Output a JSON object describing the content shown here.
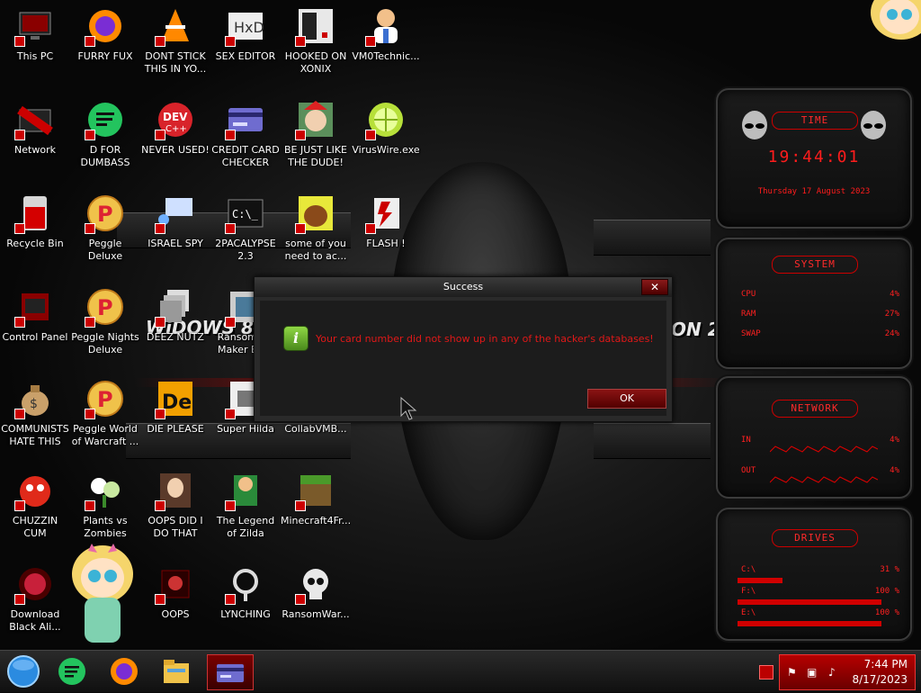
{
  "desktop_icons": [
    {
      "label": "This PC",
      "icon": "monitor-icon",
      "col": 0,
      "row": 0
    },
    {
      "label": "FURRY FUX",
      "icon": "firefox-icon",
      "col": 1,
      "row": 0
    },
    {
      "label": "DONT STICK THIS IN YO...",
      "icon": "vlc-cone-icon",
      "col": 2,
      "row": 0
    },
    {
      "label": "SEX EDITOR",
      "icon": "hxd-editor-icon",
      "col": 3,
      "row": 0
    },
    {
      "label": "HOOKED ON XONIX",
      "icon": "xonix-game-icon",
      "col": 4,
      "row": 0
    },
    {
      "label": "VM0Technic...",
      "icon": "doctor-icon",
      "col": 5,
      "row": 0
    },
    {
      "label": "Network",
      "icon": "network-icon",
      "col": 0,
      "row": 1
    },
    {
      "label": "D FOR DUMBASS",
      "icon": "discord-like-icon",
      "col": 1,
      "row": 1
    },
    {
      "label": "NEVER USED!",
      "icon": "dev-cpp-icon",
      "col": 2,
      "row": 1
    },
    {
      "label": "CREDIT CARD CHECKER",
      "icon": "credit-card-icon",
      "col": 3,
      "row": 1
    },
    {
      "label": "BE JUST LIKE THE DUDE!",
      "icon": "elf-icon",
      "col": 4,
      "row": 1
    },
    {
      "label": "VirusWire.exe",
      "icon": "lime-icon",
      "col": 5,
      "row": 1
    },
    {
      "label": "Recycle Bin",
      "icon": "recycle-bin-icon",
      "col": 0,
      "row": 2
    },
    {
      "label": "Peggle Deluxe",
      "icon": "peggle-icon",
      "col": 1,
      "row": 2
    },
    {
      "label": "ISRAEL SPY",
      "icon": "spy-icon",
      "col": 2,
      "row": 2
    },
    {
      "label": "2PACALYPSE 2.3",
      "icon": "terminal-icon",
      "col": 3,
      "row": 2
    },
    {
      "label": "some of you need to ac...",
      "icon": "beaver-icon",
      "col": 4,
      "row": 2
    },
    {
      "label": "FLASH !",
      "icon": "flash-card-icon",
      "col": 5,
      "row": 2
    },
    {
      "label": "Control Panel",
      "icon": "control-panel-icon",
      "col": 0,
      "row": 3
    },
    {
      "label": "Peggle Nights Deluxe",
      "icon": "peggle-icon",
      "col": 1,
      "row": 3
    },
    {
      "label": "DEEZ NUTZ",
      "icon": "stack-icon",
      "col": 2,
      "row": 3
    },
    {
      "label": "Ransomw... Maker Bu...",
      "icon": "ransom-maker-icon",
      "col": 3,
      "row": 3
    },
    {
      "label": "COMMUNISTS HATE THIS G...",
      "icon": "money-bag-icon",
      "col": 0,
      "row": 4
    },
    {
      "label": "Peggle World of Warcraft ...",
      "icon": "peggle-icon",
      "col": 1,
      "row": 4
    },
    {
      "label": "DIE PLEASE",
      "icon": "de-icon",
      "col": 2,
      "row": 4
    },
    {
      "label": "Super Hilda",
      "icon": "hilda-icon",
      "col": 3,
      "row": 4
    },
    {
      "label": "CollabVMB...",
      "icon": "collabvm-icon",
      "col": 4,
      "row": 4
    },
    {
      "label": "CHUZZIN CUM",
      "icon": "chuzzle-icon",
      "col": 0,
      "row": 5
    },
    {
      "label": "Plants vs Zombies",
      "icon": "plants-icon",
      "col": 1,
      "row": 5
    },
    {
      "label": "OOPS DID I DO THAT",
      "icon": "portrait-icon",
      "col": 2,
      "row": 5
    },
    {
      "label": "The Legend of Zilda",
      "icon": "zelda-icon",
      "col": 3,
      "row": 5
    },
    {
      "label": "Minecraft4Fr...",
      "icon": "minecraft-icon",
      "col": 4,
      "row": 5
    },
    {
      "label": "Download Black Ali...",
      "icon": "black-alien-icon",
      "col": 0,
      "row": 6
    },
    {
      "label": "OOPS",
      "icon": "oops-icon",
      "col": 2,
      "row": 6
    },
    {
      "label": "LYNCHING",
      "icon": "rope-icon",
      "col": 3,
      "row": 6
    },
    {
      "label": "RansomWar...",
      "icon": "skull-icon",
      "col": 4,
      "row": 6
    }
  ],
  "wallpaper": {
    "text_left": "WiDOWS 8.1",
    "text_right": "ON 20"
  },
  "gadgets": {
    "time": {
      "title": "TIME",
      "clock": "19:44:01",
      "date": "Thursday 17 August 2023"
    },
    "system": {
      "title": "SYSTEM",
      "rows": [
        {
          "label": "CPU",
          "value": "4%",
          "fill": 0.04
        },
        {
          "label": "RAM",
          "value": "27%",
          "fill": 0.27
        },
        {
          "label": "SWAP",
          "value": "24%",
          "fill": 0.24
        }
      ]
    },
    "network": {
      "title": "NETWORK",
      "rows": [
        {
          "label": "IN",
          "value": "4%"
        },
        {
          "label": "OUT",
          "value": "4%"
        }
      ]
    },
    "drives": {
      "title": "DRIVES",
      "rows": [
        {
          "label": "C:\\",
          "value": "31 %",
          "fill": 0.31
        },
        {
          "label": "F:\\",
          "value": "100 %",
          "fill": 1.0
        },
        {
          "label": "E:\\",
          "value": "100 %",
          "fill": 1.0
        }
      ]
    }
  },
  "dialog": {
    "title": "Success",
    "close_glyph": "✕",
    "icon_glyph": "i",
    "message": "Your card number did not show up in any of the hacker's databases!",
    "ok_label": "OK"
  },
  "taskbar": {
    "pinned": [
      {
        "name": "start-orb",
        "icon": "start-orb-icon"
      },
      {
        "name": "taskbar-green-app",
        "icon": "green-chat-icon"
      },
      {
        "name": "taskbar-firefox",
        "icon": "firefox-icon"
      },
      {
        "name": "taskbar-explorer",
        "icon": "folder-icon"
      },
      {
        "name": "taskbar-credit-card-checker",
        "icon": "credit-card-icon",
        "active": true
      }
    ],
    "clock_time": "7:44 PM",
    "clock_date": "8/17/2023"
  },
  "colors": {
    "accent_red": "#d00000",
    "dialog_text_red": "#e01818",
    "tray_red": "#b60000"
  }
}
